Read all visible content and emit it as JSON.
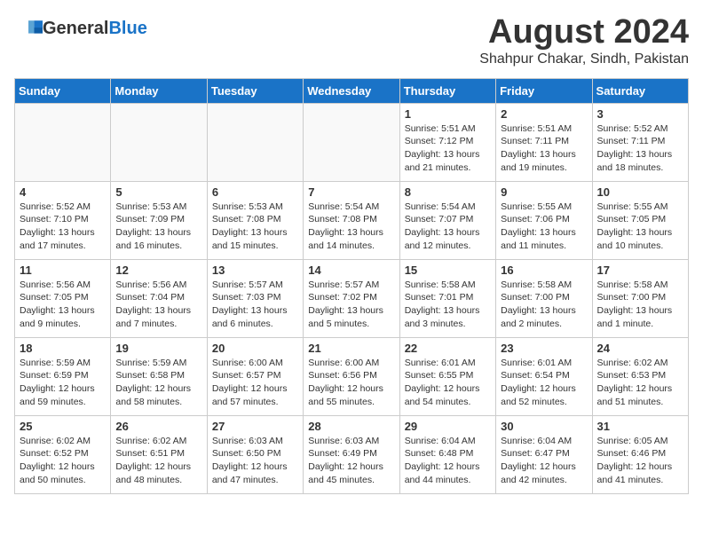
{
  "header": {
    "logo_general": "General",
    "logo_blue": "Blue",
    "month_year": "August 2024",
    "location": "Shahpur Chakar, Sindh, Pakistan"
  },
  "weekdays": [
    "Sunday",
    "Monday",
    "Tuesday",
    "Wednesday",
    "Thursday",
    "Friday",
    "Saturday"
  ],
  "weeks": [
    [
      {
        "day": "",
        "info": ""
      },
      {
        "day": "",
        "info": ""
      },
      {
        "day": "",
        "info": ""
      },
      {
        "day": "",
        "info": ""
      },
      {
        "day": "1",
        "info": "Sunrise: 5:51 AM\nSunset: 7:12 PM\nDaylight: 13 hours and 21 minutes."
      },
      {
        "day": "2",
        "info": "Sunrise: 5:51 AM\nSunset: 7:11 PM\nDaylight: 13 hours and 19 minutes."
      },
      {
        "day": "3",
        "info": "Sunrise: 5:52 AM\nSunset: 7:11 PM\nDaylight: 13 hours and 18 minutes."
      }
    ],
    [
      {
        "day": "4",
        "info": "Sunrise: 5:52 AM\nSunset: 7:10 PM\nDaylight: 13 hours and 17 minutes."
      },
      {
        "day": "5",
        "info": "Sunrise: 5:53 AM\nSunset: 7:09 PM\nDaylight: 13 hours and 16 minutes."
      },
      {
        "day": "6",
        "info": "Sunrise: 5:53 AM\nSunset: 7:08 PM\nDaylight: 13 hours and 15 minutes."
      },
      {
        "day": "7",
        "info": "Sunrise: 5:54 AM\nSunset: 7:08 PM\nDaylight: 13 hours and 14 minutes."
      },
      {
        "day": "8",
        "info": "Sunrise: 5:54 AM\nSunset: 7:07 PM\nDaylight: 13 hours and 12 minutes."
      },
      {
        "day": "9",
        "info": "Sunrise: 5:55 AM\nSunset: 7:06 PM\nDaylight: 13 hours and 11 minutes."
      },
      {
        "day": "10",
        "info": "Sunrise: 5:55 AM\nSunset: 7:05 PM\nDaylight: 13 hours and 10 minutes."
      }
    ],
    [
      {
        "day": "11",
        "info": "Sunrise: 5:56 AM\nSunset: 7:05 PM\nDaylight: 13 hours and 9 minutes."
      },
      {
        "day": "12",
        "info": "Sunrise: 5:56 AM\nSunset: 7:04 PM\nDaylight: 13 hours and 7 minutes."
      },
      {
        "day": "13",
        "info": "Sunrise: 5:57 AM\nSunset: 7:03 PM\nDaylight: 13 hours and 6 minutes."
      },
      {
        "day": "14",
        "info": "Sunrise: 5:57 AM\nSunset: 7:02 PM\nDaylight: 13 hours and 5 minutes."
      },
      {
        "day": "15",
        "info": "Sunrise: 5:58 AM\nSunset: 7:01 PM\nDaylight: 13 hours and 3 minutes."
      },
      {
        "day": "16",
        "info": "Sunrise: 5:58 AM\nSunset: 7:00 PM\nDaylight: 13 hours and 2 minutes."
      },
      {
        "day": "17",
        "info": "Sunrise: 5:58 AM\nSunset: 7:00 PM\nDaylight: 13 hours and 1 minute."
      }
    ],
    [
      {
        "day": "18",
        "info": "Sunrise: 5:59 AM\nSunset: 6:59 PM\nDaylight: 12 hours and 59 minutes."
      },
      {
        "day": "19",
        "info": "Sunrise: 5:59 AM\nSunset: 6:58 PM\nDaylight: 12 hours and 58 minutes."
      },
      {
        "day": "20",
        "info": "Sunrise: 6:00 AM\nSunset: 6:57 PM\nDaylight: 12 hours and 57 minutes."
      },
      {
        "day": "21",
        "info": "Sunrise: 6:00 AM\nSunset: 6:56 PM\nDaylight: 12 hours and 55 minutes."
      },
      {
        "day": "22",
        "info": "Sunrise: 6:01 AM\nSunset: 6:55 PM\nDaylight: 12 hours and 54 minutes."
      },
      {
        "day": "23",
        "info": "Sunrise: 6:01 AM\nSunset: 6:54 PM\nDaylight: 12 hours and 52 minutes."
      },
      {
        "day": "24",
        "info": "Sunrise: 6:02 AM\nSunset: 6:53 PM\nDaylight: 12 hours and 51 minutes."
      }
    ],
    [
      {
        "day": "25",
        "info": "Sunrise: 6:02 AM\nSunset: 6:52 PM\nDaylight: 12 hours and 50 minutes."
      },
      {
        "day": "26",
        "info": "Sunrise: 6:02 AM\nSunset: 6:51 PM\nDaylight: 12 hours and 48 minutes."
      },
      {
        "day": "27",
        "info": "Sunrise: 6:03 AM\nSunset: 6:50 PM\nDaylight: 12 hours and 47 minutes."
      },
      {
        "day": "28",
        "info": "Sunrise: 6:03 AM\nSunset: 6:49 PM\nDaylight: 12 hours and 45 minutes."
      },
      {
        "day": "29",
        "info": "Sunrise: 6:04 AM\nSunset: 6:48 PM\nDaylight: 12 hours and 44 minutes."
      },
      {
        "day": "30",
        "info": "Sunrise: 6:04 AM\nSunset: 6:47 PM\nDaylight: 12 hours and 42 minutes."
      },
      {
        "day": "31",
        "info": "Sunrise: 6:05 AM\nSunset: 6:46 PM\nDaylight: 12 hours and 41 minutes."
      }
    ]
  ]
}
